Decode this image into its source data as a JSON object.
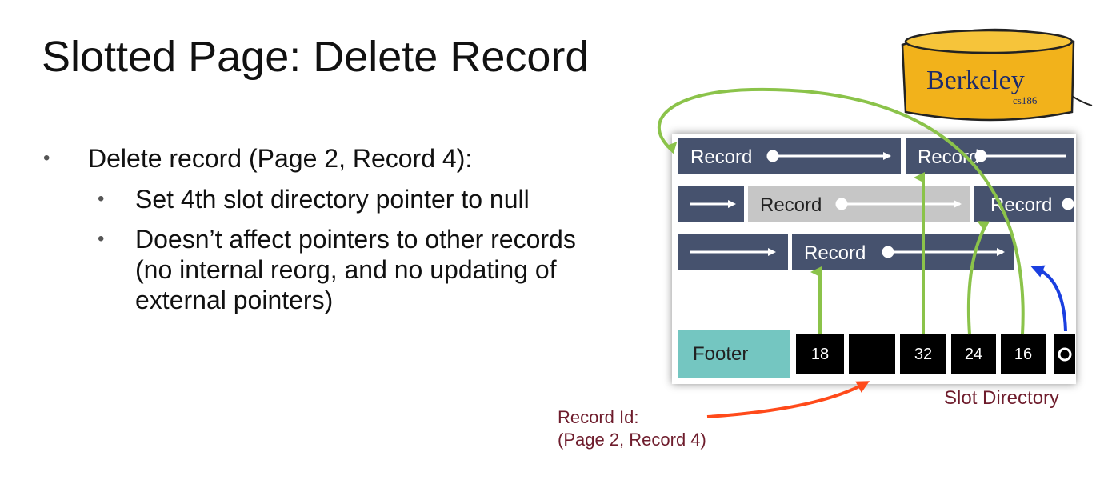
{
  "slide": {
    "title": "Slotted Page: Delete Record",
    "bullets": [
      {
        "text": "Delete record (Page 2, Record 4):",
        "sub": [
          "Set 4th slot directory pointer to null",
          "Doesn’t affect pointers to other records (no internal reorg, and no updating of external pointers)"
        ]
      }
    ]
  },
  "logo": {
    "name": "Berkeley",
    "course": "cs186"
  },
  "page": {
    "records": [
      "Record",
      "Record",
      "Record",
      "Record",
      "Record"
    ],
    "footer": "Footer",
    "slots": [
      "18",
      "",
      "32",
      "24",
      "16"
    ],
    "slot_directory_label": "Slot Directory",
    "record_id_label": [
      "Record Id:",
      "(Page 2, Record 4)"
    ]
  },
  "colors": {
    "record": "#46526e",
    "deleted_record": "#c6c6c6",
    "footer": "#74c6c1",
    "slot_pointer": "#8bc34a",
    "free_space_pointer": "#1a3fe0",
    "record_id_arrow": "#ff4a1a",
    "annotation": "#6e1c2c",
    "logo_fill": "#f2b21b"
  }
}
